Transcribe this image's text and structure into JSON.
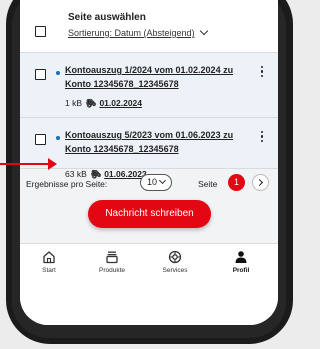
{
  "list_header": {
    "select_all_label": "Seite auswählen",
    "sort_label": "Sortierung: Datum (Absteigend)"
  },
  "messages": [
    {
      "title": "Kontoauszug 1/2024 vom 01.02.2024 zu Konto 12345678_12345678",
      "size": "1 kB",
      "date": "01.02.2024"
    },
    {
      "title": "Kontoauszug 5/2023 vom 01.06.2023 zu Konto 12345678_12345678",
      "size": "63 kB",
      "date": "01.06.2023"
    }
  ],
  "pagination": {
    "per_page_label": "Ergebnisse pro Seite:",
    "per_page_value": "10",
    "page_label": "Seite",
    "current_page": "1"
  },
  "primary_action": "Nachricht schreiben",
  "bottom_nav": {
    "items": [
      {
        "label": "Start",
        "icon": "home-icon"
      },
      {
        "label": "Produkte",
        "icon": "products-icon"
      },
      {
        "label": "Services",
        "icon": "services-icon"
      },
      {
        "label": "Profil",
        "icon": "profile-icon"
      }
    ],
    "active": "Profil"
  },
  "colors": {
    "accent": "#e30613",
    "unread_dot": "#1c6db5",
    "item_background": "#edf2f8"
  }
}
